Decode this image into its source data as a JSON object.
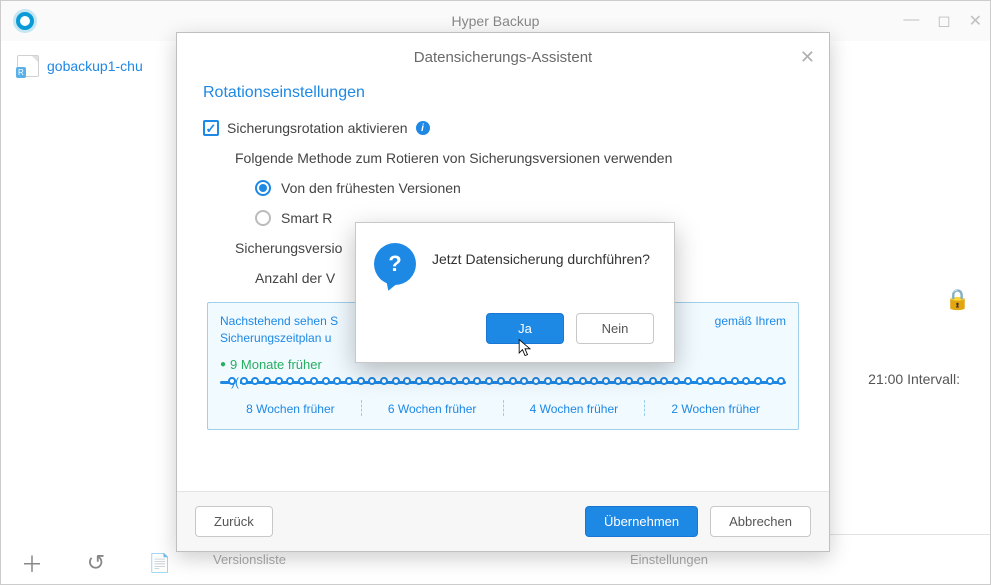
{
  "titlebar": {
    "title": "Hyper Backup"
  },
  "sidebar": {
    "item1": "gobackup1-chu"
  },
  "right_info": "21:00 Intervall:",
  "bottom_ghost1": "Versionsliste",
  "bottom_ghost2": "Einstellungen",
  "wizard": {
    "title": "Datensicherungs-Assistent",
    "section": "Rotationseinstellungen",
    "enable_label": "Sicherungsrotation aktivieren",
    "method_label": "Folgende Methode zum Rotieren von Sicherungsversionen verwenden",
    "radio1": "Von den frühesten Versionen",
    "radio2": "Smart R",
    "versions_label": "Sicherungsversio",
    "count_label": "Anzahl der V",
    "timeline": {
      "intro1": "Nachstehend sehen S",
      "intro2": "Sicherungszeitplan u",
      "intro_tail": "gemäß Ihrem",
      "marker": "9 Monate früher",
      "l1": "8 Wochen früher",
      "l2": "6 Wochen früher",
      "l3": "4 Wochen früher",
      "l4": "2 Wochen früher"
    },
    "back": "Zurück",
    "apply": "Übernehmen",
    "cancel": "Abbrechen"
  },
  "confirm": {
    "text": "Jetzt Datensicherung durchführen?",
    "yes": "Ja",
    "no": "Nein"
  }
}
